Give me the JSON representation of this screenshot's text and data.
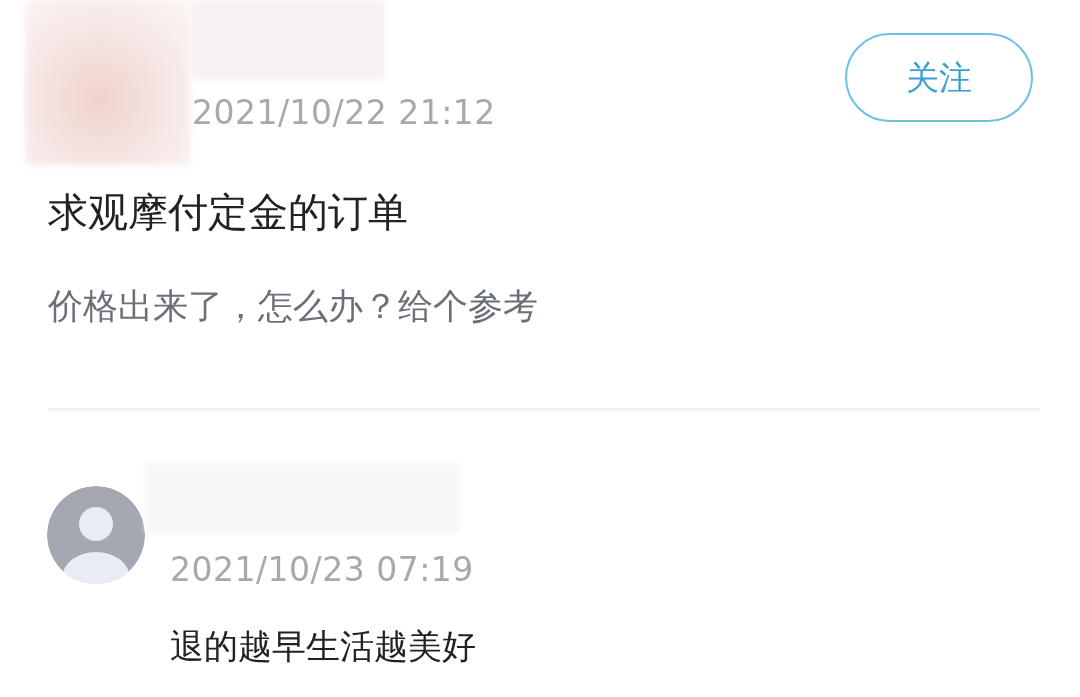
{
  "post": {
    "timestamp": "2021/10/22 21:12",
    "follow_label": "关注",
    "title": "求观摩付定金的订单",
    "body": "价格出来了，怎么办？给个参考"
  },
  "comments": [
    {
      "timestamp": "2021/10/23 07:19",
      "text": "退的越早生活越美好"
    }
  ]
}
